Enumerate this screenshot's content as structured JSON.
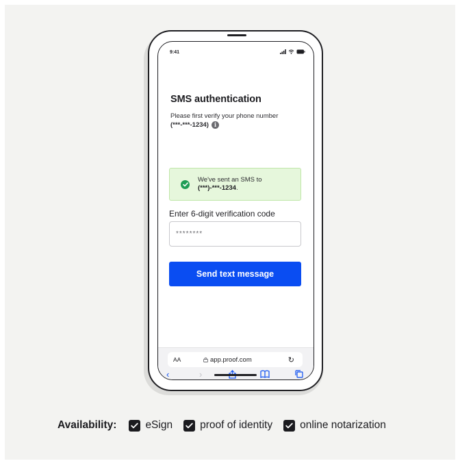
{
  "status_bar": {
    "time": "9:41"
  },
  "screen": {
    "title": "SMS authentication",
    "subtitle": "Please first verify your phone number",
    "masked_phone": "(***-***-1234)",
    "info_icon": "info-icon",
    "alert": {
      "line1": "We've sent an SMS to",
      "line2": "(***)-***-1234",
      "line2_suffix": ".",
      "icon": "check-circle-icon",
      "color": "#1f9d55"
    },
    "code_label": "Enter 6-digit verification code",
    "code_value": "********",
    "send_button": "Send text message",
    "accent_color": "#0a4df2"
  },
  "browser": {
    "text_size": "AA",
    "url": "app.proof.com",
    "icons": [
      "back-icon",
      "forward-icon",
      "share-icon",
      "bookmarks-icon",
      "tabs-icon",
      "reload-icon",
      "lock-icon"
    ]
  },
  "availability": {
    "label": "Availability:",
    "items": [
      "eSign",
      "proof of identity",
      "online notarization"
    ]
  }
}
